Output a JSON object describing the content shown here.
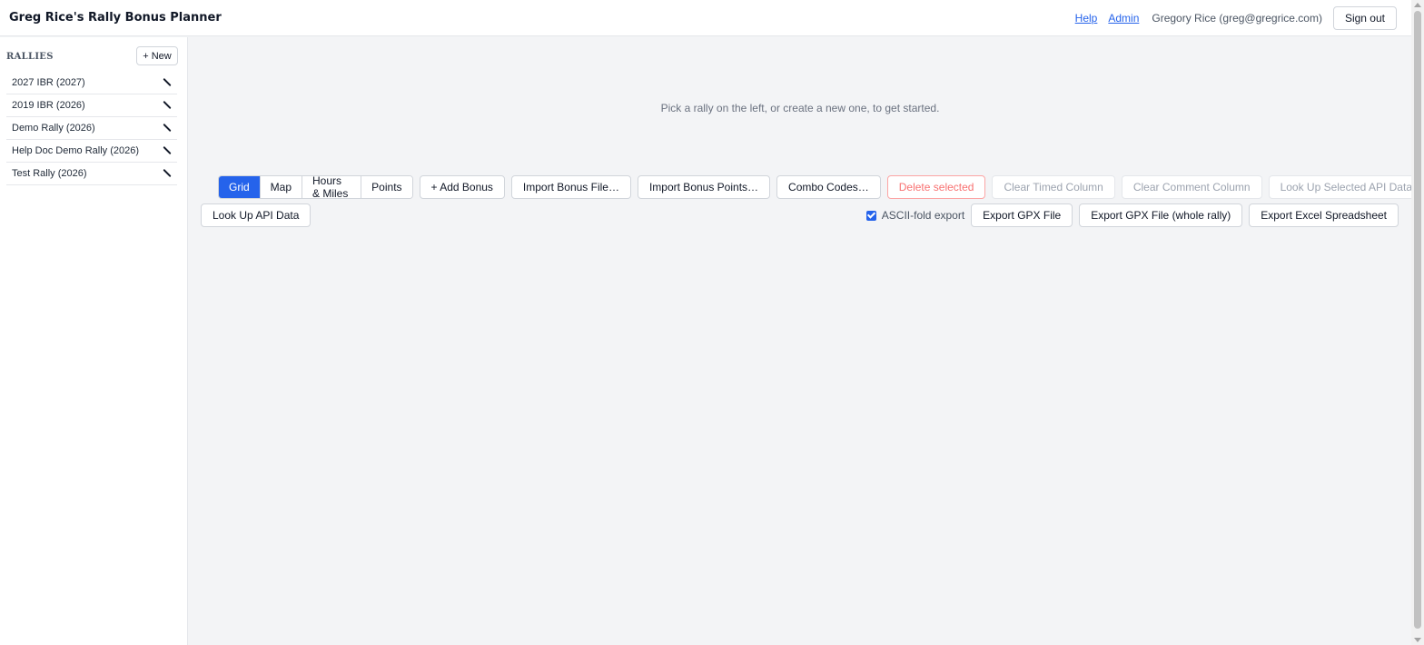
{
  "header": {
    "title": "Greg Rice's Rally Bonus Planner",
    "help_link": "Help",
    "admin_link": "Admin",
    "user_label": "Gregory Rice (greg@gregrice.com)",
    "sign_out": "Sign out"
  },
  "sidebar": {
    "heading": "RALLIES",
    "new_button": "+ New",
    "items": [
      {
        "label": "2027 IBR (2027)"
      },
      {
        "label": "2019 IBR (2026)"
      },
      {
        "label": "Demo Rally (2026)"
      },
      {
        "label": "Help Doc Demo Rally (2026)"
      },
      {
        "label": "Test Rally (2026)"
      }
    ]
  },
  "main": {
    "empty_message": "Pick a rally on the left, or create a new one, to get started.",
    "view_tabs": [
      "Grid",
      "Map",
      "Hours & Miles",
      "Points"
    ],
    "active_tab": "Grid",
    "toolbar": {
      "add_bonus": "+ Add Bonus",
      "import_bonus_file": "Import Bonus File…",
      "import_bonus_points": "Import Bonus Points…",
      "combo_codes": "Combo Codes…",
      "delete_selected": "Delete selected",
      "clear_timed": "Clear Timed Column",
      "clear_comment": "Clear Comment Column",
      "lookup_selected_api": "Look Up Selected API Data",
      "lookup_api": "Look Up API Data",
      "ascii_fold": "ASCII-fold export",
      "ascii_fold_checked": true,
      "export_gpx": "Export GPX File",
      "export_gpx_whole": "Export GPX File (whole rally)",
      "export_excel": "Export Excel Spreadsheet"
    }
  },
  "colors": {
    "accent": "#2563eb",
    "background": "#f3f4f6",
    "danger": "#f87171"
  }
}
